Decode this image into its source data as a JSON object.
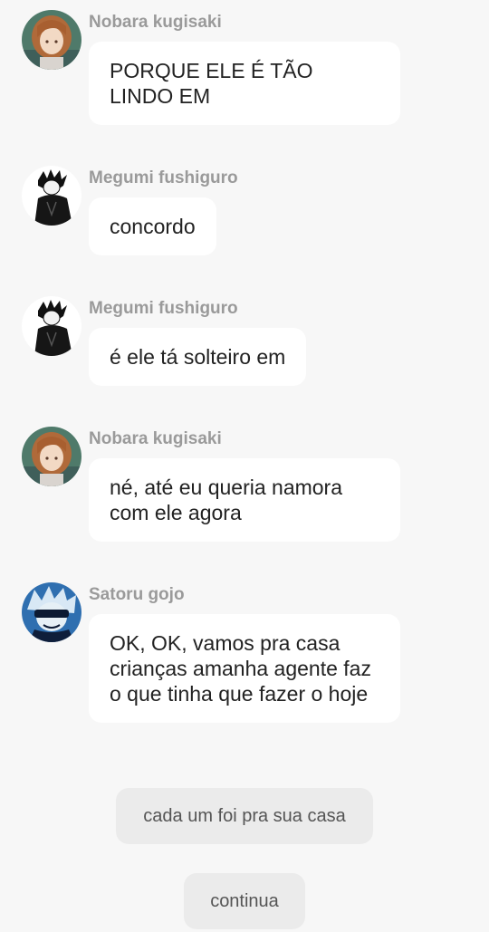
{
  "messages": [
    {
      "sender": "Nobara kugisaki",
      "avatar": "nobara-avatar",
      "text": "PORQUE ELE É TÃO LINDO EM"
    },
    {
      "sender": "Megumi fushiguro",
      "avatar": "megumi-avatar",
      "text": "concordo"
    },
    {
      "sender": "Megumi fushiguro",
      "avatar": "megumi-avatar",
      "text": "é ele tá solteiro em"
    },
    {
      "sender": "Nobara kugisaki",
      "avatar": "nobara-avatar",
      "text": "né, até eu queria namora com ele agora"
    },
    {
      "sender": "Satoru gojo",
      "avatar": "gojo-avatar",
      "text": "OK, OK, vamos pra casa crianças amanha agente faz o que tinha que fazer o hoje"
    }
  ],
  "narration": "cada um foi pra sua casa",
  "continue_label": "continua",
  "colors": {
    "background": "#f7f7f7",
    "bubble": "#ffffff",
    "name": "#9a9a9a",
    "narration_bg": "#ebebeb"
  }
}
